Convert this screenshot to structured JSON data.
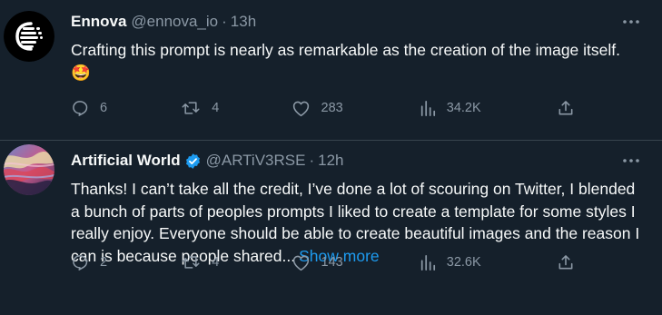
{
  "tweets": [
    {
      "author_name": "Ennova",
      "verified": false,
      "handle": "@ennova_io",
      "time": "13h",
      "text": "Crafting this prompt is nearly as remarkable as the creation of the image itself.",
      "emoji": "🤩",
      "show_more": "",
      "replies": "6",
      "retweets": "4",
      "likes": "283",
      "views": "34.2K"
    },
    {
      "author_name": "Artificial World",
      "verified": true,
      "handle": "@ARTiV3RSE",
      "time": "12h",
      "text": "Thanks! I can’t take all the credit, I’ve done a lot of scouring on Twitter, I blended a bunch of parts of peoples prompts I liked to create a template for some styles I really enjoy. Everyone should be able to create beautiful images and the reason I can is because people shared...",
      "emoji": "",
      "show_more": "Show more",
      "replies": "2",
      "retweets": "4",
      "likes": "143",
      "views": "32.6K"
    }
  ],
  "colors": {
    "background": "#15202b",
    "text": "#f7f9f9",
    "secondary": "#8b98a5",
    "accent": "#1d9bf0",
    "divider": "#38444d"
  },
  "icons": [
    "more-icon",
    "reply-icon",
    "retweet-icon",
    "like-icon",
    "views-icon",
    "share-icon",
    "verified-badge-icon"
  ]
}
